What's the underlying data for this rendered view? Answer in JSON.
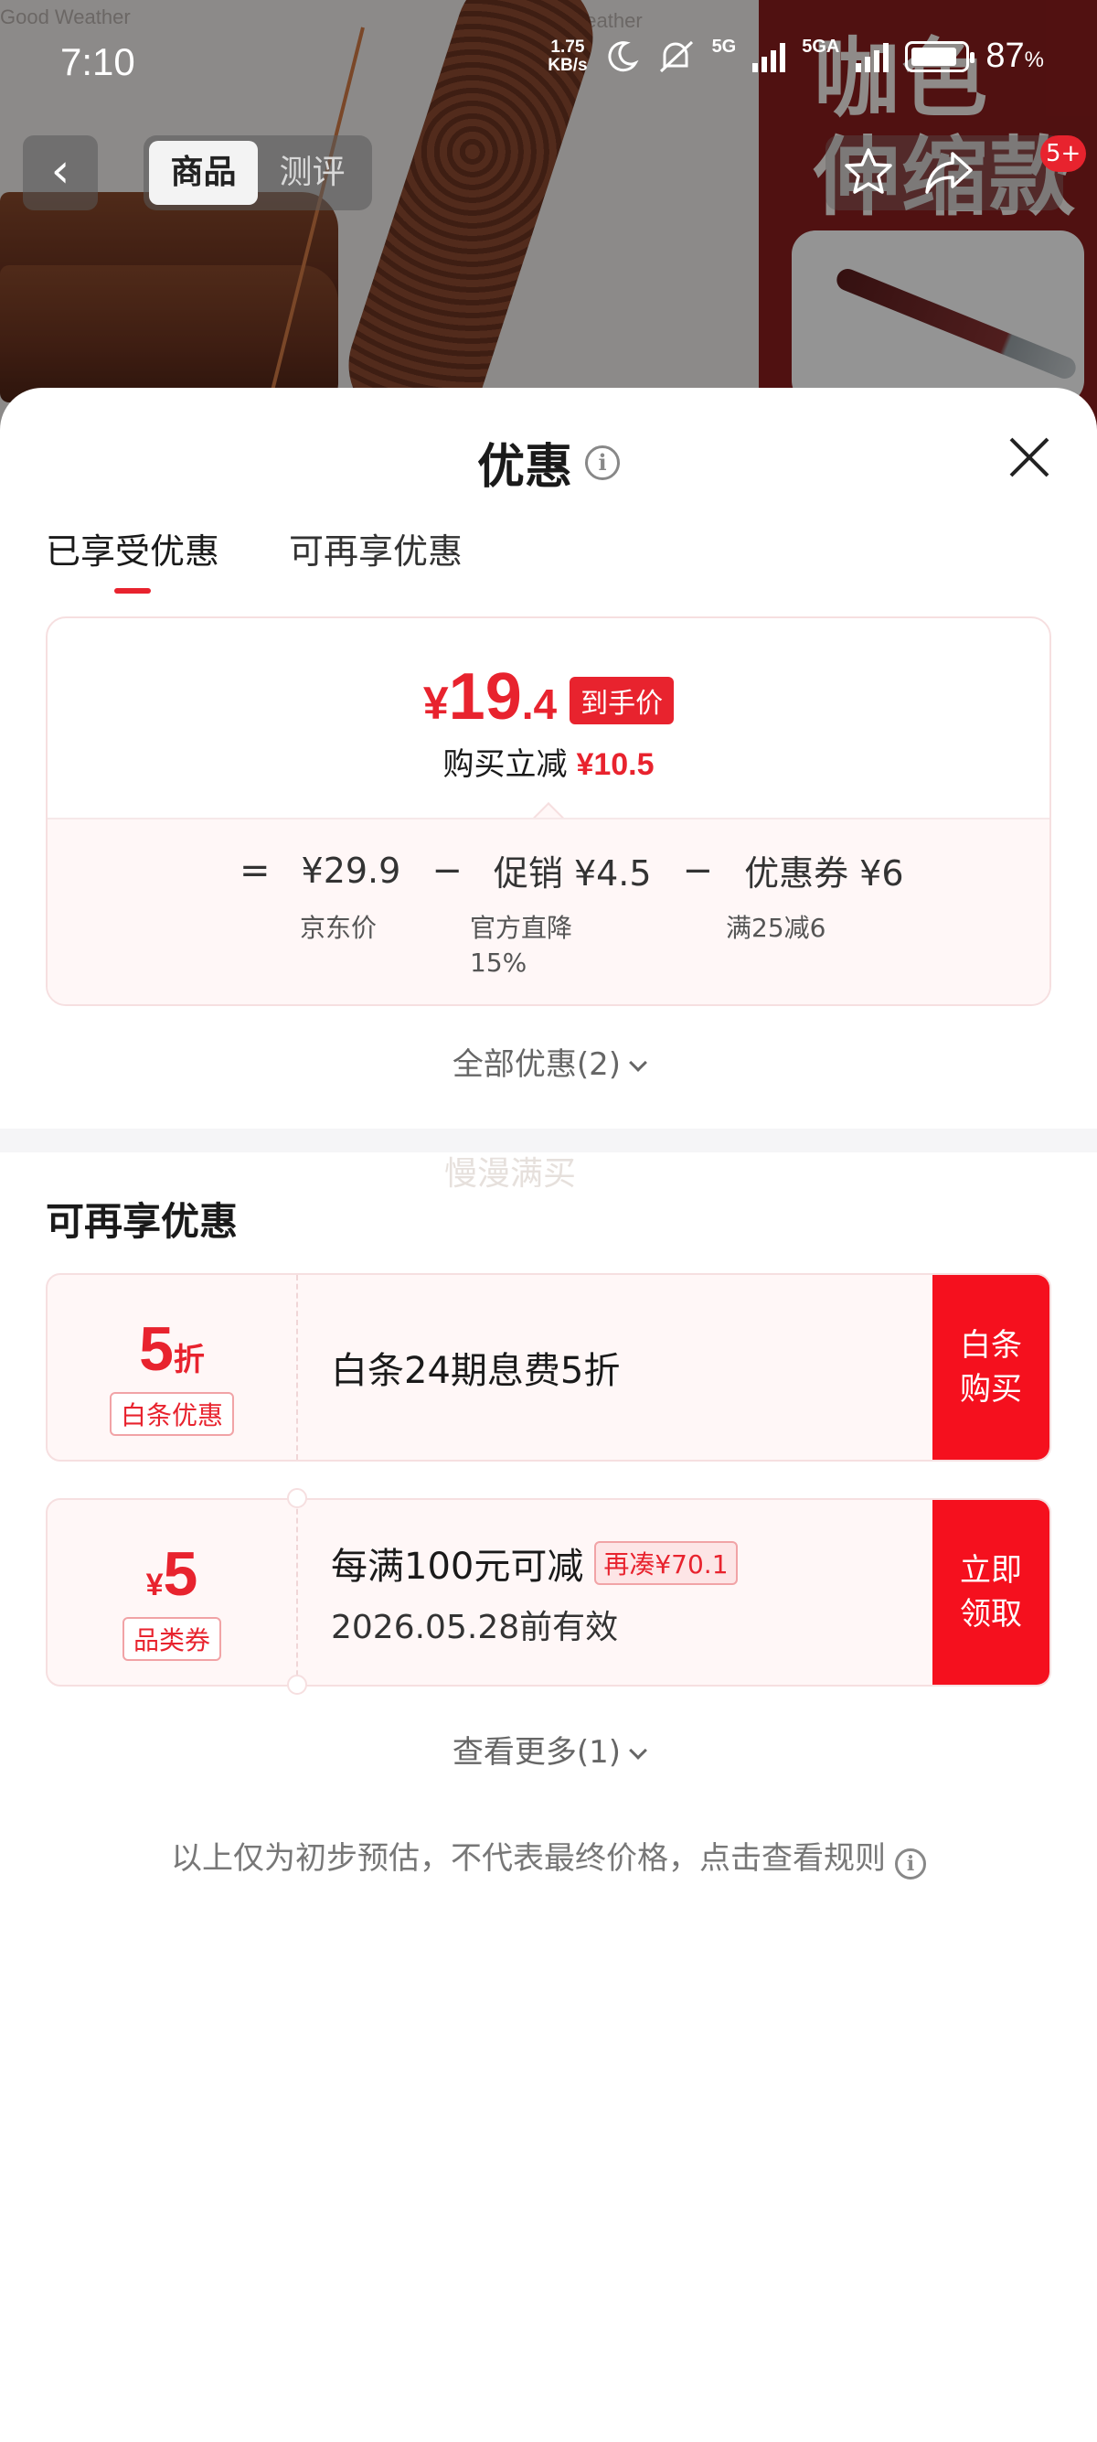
{
  "status_bar": {
    "time": "7:10",
    "net_speed_value": "1.75",
    "net_speed_unit": "KB/s",
    "net1": "5G",
    "net2": "5GA",
    "battery_pct": "87",
    "battery_unit": "%",
    "battery_level": 0.87
  },
  "product_nav": {
    "tab_goods": "商品",
    "tab_reviews": "测评",
    "cart_badge": "5+"
  },
  "background_product": {
    "watermark": "Good Weather",
    "color_text_line1": "咖色",
    "color_text_line2": "伸缩款"
  },
  "sheet": {
    "title": "优惠",
    "tabs": [
      "已享受优惠",
      "可再享优惠"
    ],
    "price_card": {
      "currency": "¥",
      "price_int": "19",
      "price_dec": ".4",
      "price_tag": "到手价",
      "saving_label": "购买立减",
      "saving_value": "¥10.5",
      "equals": "=",
      "minus": "−",
      "jd_price": "¥29.9",
      "jd_label": "京东价",
      "promo_label": "促销",
      "promo_value": "¥4.5",
      "promo_sub1": "官方直降",
      "promo_sub2": "15%",
      "coupon_label": "优惠券",
      "coupon_value": "¥6",
      "coupon_sub": "满25减6"
    },
    "all_offers": "全部优惠(2)",
    "ghost_text": "慢漫满买",
    "section_title": "可再享优惠",
    "coupons": [
      {
        "value": "5",
        "unit": "折",
        "label": "白条优惠",
        "title": "白条24期息费5折",
        "cta_line1": "白条",
        "cta_line2": "购买"
      },
      {
        "currency": "¥",
        "value": "5",
        "label": "品类券",
        "title": "每满100元可减",
        "chip": "再凑¥70.1",
        "subtitle": "2026.05.28前有效",
        "cta_line1": "立即",
        "cta_line2": "领取"
      }
    ],
    "see_more": "查看更多(1)",
    "disclaimer": "以上仅为初步预估，不代表最终价格，点击查看规则"
  },
  "colors": {
    "accent": "#e8232e",
    "cta": "#f5101e",
    "card_bg": "#fff7f7"
  }
}
